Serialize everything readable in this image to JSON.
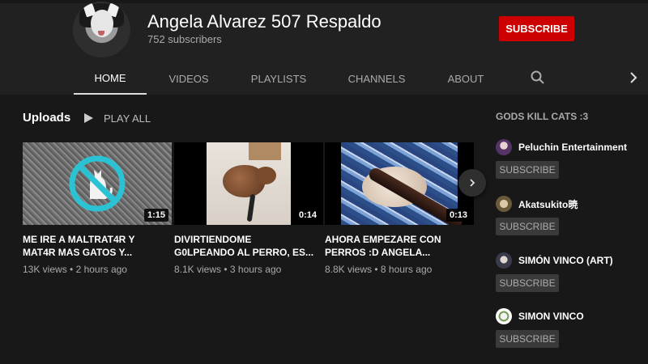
{
  "channel": {
    "name": "Angela Alvarez 507 Respaldo",
    "subscribers": "752 subscribers",
    "subscribe_label": "SUBSCRIBE"
  },
  "tabs": [
    {
      "label": "HOME",
      "active": true
    },
    {
      "label": "VIDEOS",
      "active": false
    },
    {
      "label": "PLAYLISTS",
      "active": false
    },
    {
      "label": "CHANNELS",
      "active": false
    },
    {
      "label": "ABOUT",
      "active": false
    }
  ],
  "uploads": {
    "title": "Uploads",
    "play_all": "PLAY ALL",
    "videos": [
      {
        "title": "ME IRE A MALTRAT4R Y\nMAT4R MAS GATOS Y...",
        "duration": "1:15",
        "views": "13K views",
        "age": "2 hours ago"
      },
      {
        "title": "DIVIRTIENDOME\nG0LPEANDO AL PERRO, ES...",
        "duration": "0:14",
        "views": "8.1K views",
        "age": "3 hours ago"
      },
      {
        "title": "AHORA EMPEZARE CON\nPERROS :D ANGELA...",
        "duration": "0:13",
        "views": "8.8K views",
        "age": "8 hours ago"
      }
    ]
  },
  "featured": {
    "title": "GODS KILL CATS :3",
    "channels": [
      {
        "name": "Peluchin Entertainment",
        "subscribe_label": "SUBSCRIBE"
      },
      {
        "name": "Akatsukito暁",
        "subscribe_label": "SUBSCRIBE"
      },
      {
        "name": "SIMÓN VINCO (ART)",
        "subscribe_label": "SUBSCRIBE"
      },
      {
        "name": "SIMON VINCO",
        "subscribe_label": "SUBSCRIBE"
      }
    ]
  },
  "colors": {
    "background": "#181818",
    "header": "#212121",
    "subscribe_red": "#cc0000"
  },
  "icons": [
    "search-icon",
    "chevron-right-icon",
    "play-icon",
    "no-cat-icon"
  ]
}
